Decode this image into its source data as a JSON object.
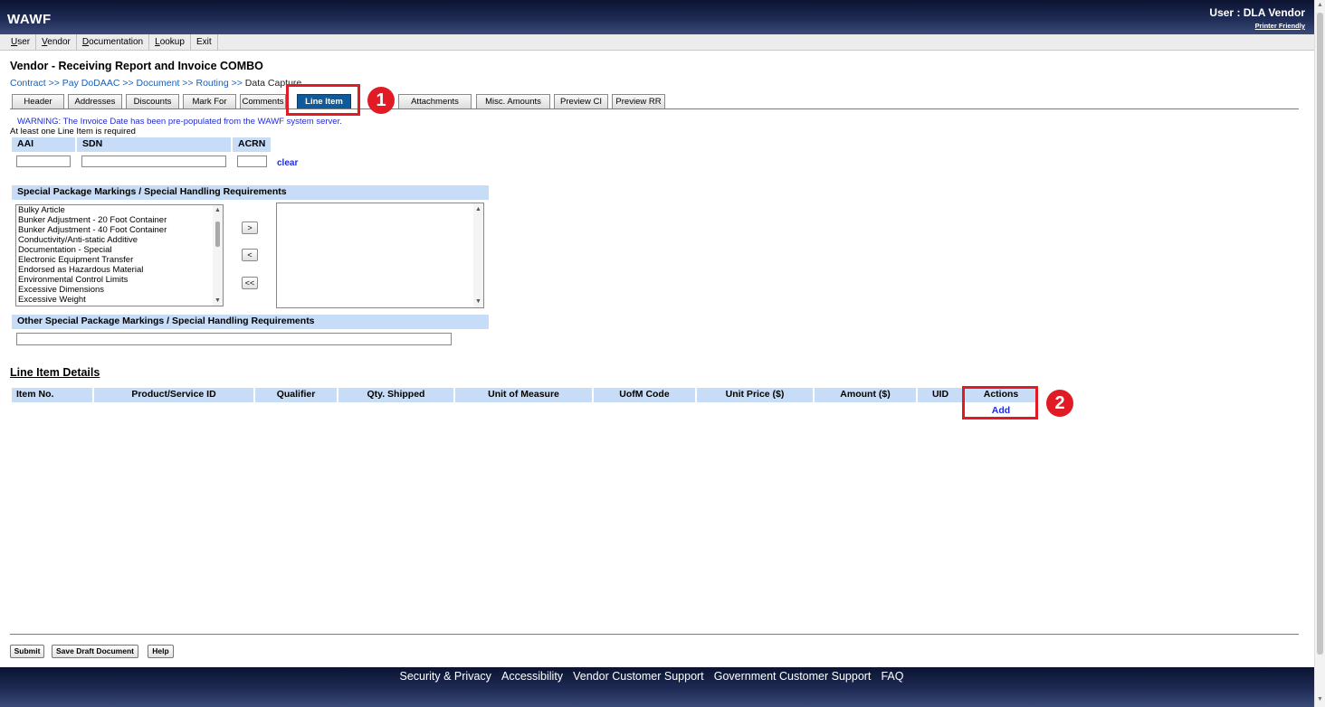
{
  "app": {
    "logo": "WAWF",
    "user": "User : DLA Vendor",
    "printer_friendly": "Printer Friendly"
  },
  "menu": [
    {
      "u": "U",
      "rest": "ser"
    },
    {
      "u": "V",
      "rest": "endor"
    },
    {
      "u": "D",
      "rest": "ocumentation"
    },
    {
      "u": "L",
      "rest": "ookup"
    },
    {
      "u": "",
      "rest": "Exit"
    }
  ],
  "page_title": "Vendor - Receiving Report and Invoice COMBO",
  "breadcrumb": {
    "items": [
      "Contract",
      "Pay DoDAAC",
      "Document",
      "Routing"
    ],
    "separator": ">>",
    "current": "Data Capture"
  },
  "tabs": [
    "Header",
    "Addresses",
    "Discounts",
    "Mark For",
    "Comments",
    "Line Item",
    "Attachments",
    "Misc. Amounts",
    "Preview CI",
    "Preview RR"
  ],
  "active_tab": "Line Item",
  "annotations": {
    "marker_1": "1",
    "marker_2": "2",
    "color": "#e01b24"
  },
  "warning": "WARNING: The Invoice Date has been pre-populated from the WAWF system server.",
  "required_note": "At least one Line Item is required",
  "fields": {
    "aai_label": "AAI",
    "sdn_label": "SDN",
    "acrn_label": "ACRN",
    "aai_value": "",
    "sdn_value": "",
    "acrn_value": "",
    "clear_link": "clear"
  },
  "special_markings": {
    "title": "Special Package Markings / Special Handling Requirements",
    "available": [
      "Bulky Article",
      "Bunker Adjustment - 20 Foot Container",
      "Bunker Adjustment - 40 Foot Container",
      "Conductivity/Anti-static Additive",
      "Documentation - Special",
      "Electronic Equipment Transfer",
      "Endorsed as Hazardous Material",
      "Environmental Control Limits",
      "Excessive Dimensions",
      "Excessive Weight"
    ],
    "buttons": {
      "add": ">",
      "remove": "<",
      "remove_all": "<<"
    },
    "other_title": "Other Special Package Markings / Special Handling Requirements",
    "other_value": ""
  },
  "line_items": {
    "heading": "Line Item Details",
    "columns": [
      "Item No.",
      "Product/Service ID",
      "Qualifier",
      "Qty. Shipped",
      "Unit of Measure",
      "UofM Code",
      "Unit Price ($)",
      "Amount ($)",
      "UID",
      "Actions"
    ],
    "add_link": "Add"
  },
  "bottom_buttons": {
    "submit": "Submit",
    "save_draft": "Save Draft Document",
    "help": "Help"
  },
  "footer": [
    "Security & Privacy",
    "Accessibility",
    "Vendor Customer Support",
    "Government Customer Support",
    "FAQ"
  ],
  "colors": {
    "header_bg": "#1e2b55",
    "section_bg": "#c7dcf6",
    "link": "#1f2bd6",
    "active_tab": "#0e5a9a"
  }
}
